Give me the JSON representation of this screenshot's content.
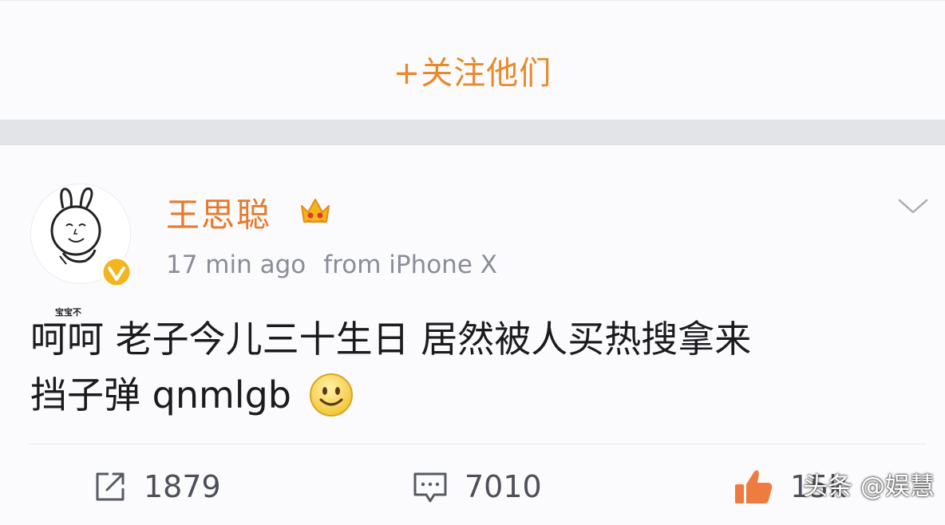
{
  "follow": {
    "label": "+关注他们"
  },
  "post": {
    "username": "王思聪",
    "avatar_caption": "宝宝不",
    "timestamp": "17 min ago",
    "source": "from iPhone X",
    "text_line1": "呵呵 老子今儿三十生日 居然被人买热搜拿来",
    "text_line2": "挡子弹 qnmlgb",
    "emoji": "smile-emoji"
  },
  "actions": {
    "reposts": "1879",
    "comments": "7010",
    "likes": "15k"
  },
  "watermark": "头条 @娱慧",
  "colors": {
    "accent": "#e8892c",
    "username": "#e8792a",
    "meta": "#8a8d99",
    "text": "#1b1b1f",
    "verified": "#f3b51b",
    "like": "#f07b3f"
  },
  "icons": {
    "repost": "repost-icon",
    "comment": "comment-icon",
    "like": "thumbs-up-icon",
    "verified": "verified-badge-icon",
    "crown": "crown-badge-icon",
    "more": "chevron-down-icon"
  }
}
